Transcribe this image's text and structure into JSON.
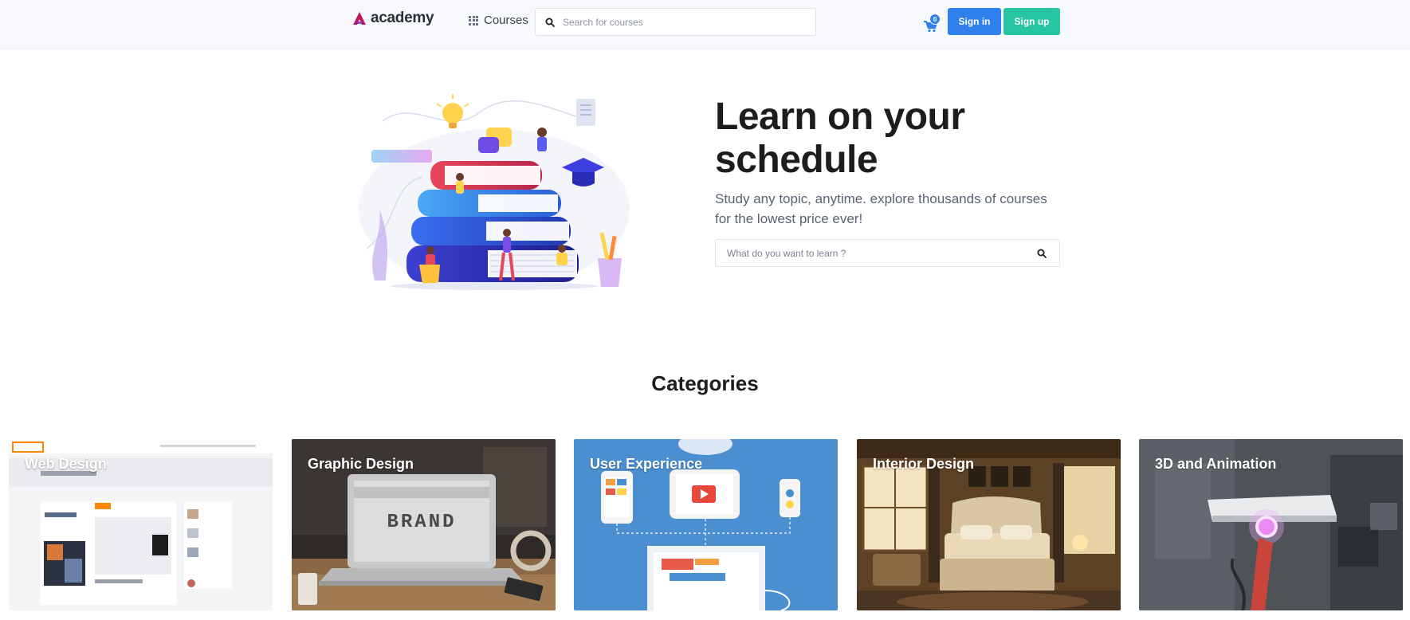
{
  "header": {
    "logo_text": "academy",
    "courses_label": "Courses",
    "search_placeholder": "Search for courses",
    "cart_count": "0",
    "signin_label": "Sign in",
    "signup_label": "Sign up"
  },
  "hero": {
    "title": "Learn on your schedule",
    "subtitle": "Study any topic, anytime. explore thousands of courses for the lowest price ever!",
    "search_placeholder": "What do you want to learn ?"
  },
  "categories": {
    "title": "Categories",
    "items": [
      {
        "label": "Web Design"
      },
      {
        "label": "Graphic Design"
      },
      {
        "label": "User Experience"
      },
      {
        "label": "Interior Design"
      },
      {
        "label": "3D and Animation"
      }
    ]
  },
  "colors": {
    "primary": "#2f80ed",
    "secondary": "#25c6a1",
    "brand": "#c2185b",
    "header_bg": "#f7f9fc"
  },
  "icons": {
    "logo": "academy-logo-icon",
    "courses": "grid-icon",
    "search": "search-icon",
    "cart": "cart-icon"
  }
}
